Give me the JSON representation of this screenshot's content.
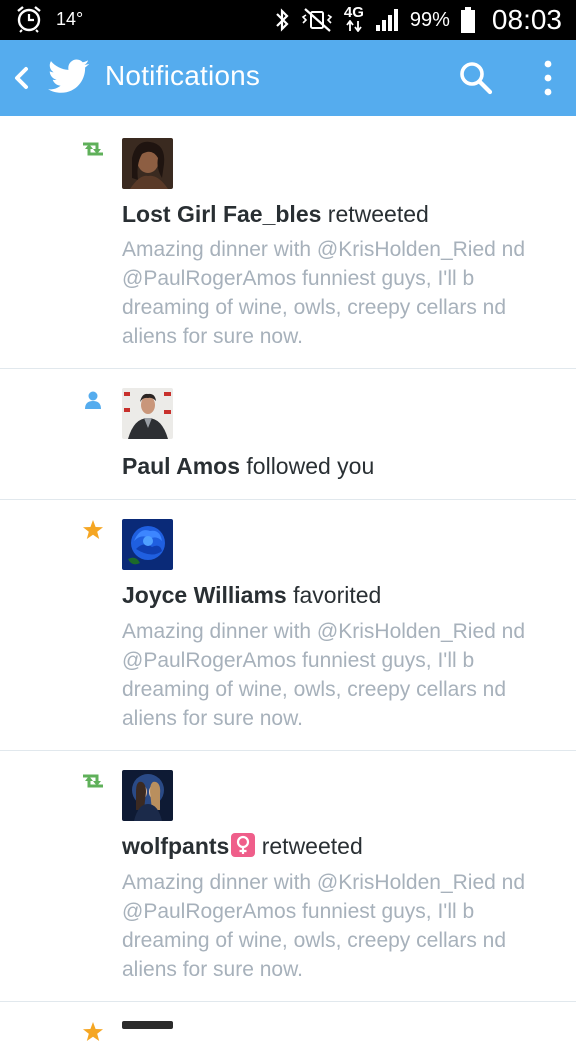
{
  "status_bar": {
    "temperature": "14°",
    "network": "4G",
    "battery_pct": "99%",
    "time": "08:03"
  },
  "app_bar": {
    "title": "Notifications",
    "color": "#55acee"
  },
  "notifications": [
    {
      "type": "retweet",
      "type_color": "#5fb05a",
      "name": "Lost Girl Fae_bles",
      "action": "retweeted",
      "tweet": "Amazing dinner with @KrisHolden_Ried nd @PaulRogerAmos funniest guys, I'll b dreaming of wine, owls, creepy cellars nd aliens for sure now."
    },
    {
      "type": "follow",
      "type_color": "#55acee",
      "name": "Paul Amos",
      "action": "followed you"
    },
    {
      "type": "favorite",
      "type_color": "#f5a623",
      "name": "Joyce Williams",
      "action": "favorited",
      "tweet": "Amazing dinner with @KrisHolden_Ried nd @PaulRogerAmos funniest guys, I'll b dreaming of wine, owls, creepy cellars nd aliens for sure now."
    },
    {
      "type": "retweet",
      "type_color": "#5fb05a",
      "name": "wolfpants",
      "name_emoji": "female-sign-emoji",
      "action": "retweeted",
      "tweet": "Amazing dinner with @KrisHolden_Ried nd @PaulRogerAmos funniest guys, I'll b dreaming of wine, owls, creepy cellars nd aliens for sure now."
    }
  ]
}
